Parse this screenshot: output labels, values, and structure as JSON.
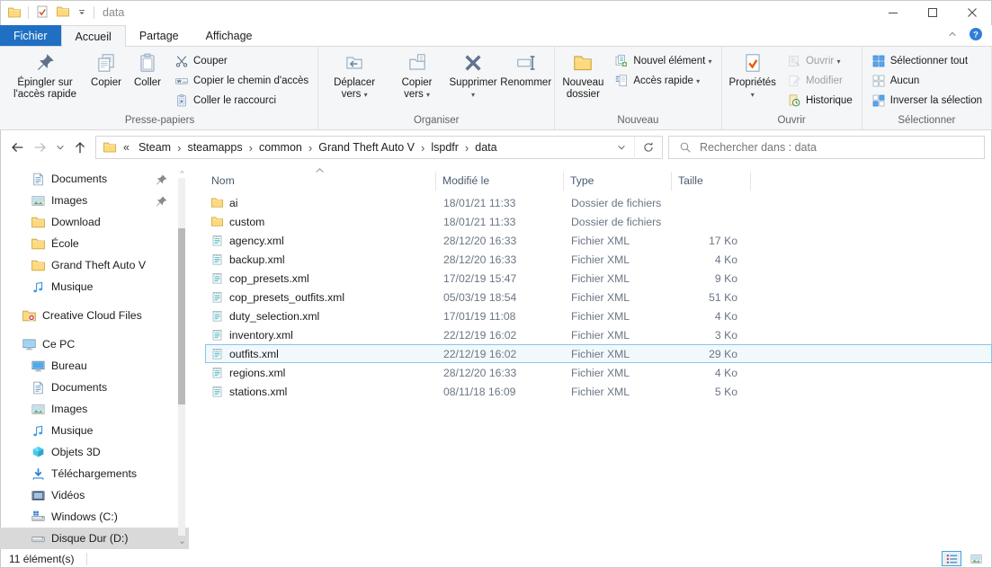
{
  "titlebar": {
    "title": "data"
  },
  "tabs": {
    "file_label": "Fichier",
    "items": [
      {
        "label": "Accueil",
        "active": true
      },
      {
        "label": "Partage",
        "active": false
      },
      {
        "label": "Affichage",
        "active": false
      }
    ]
  },
  "ribbon": {
    "groups": [
      {
        "label": "Presse-papiers",
        "blocks": [
          {
            "kind": "large",
            "label": "Épingler sur l'accès rapide",
            "icon": "pin-icon"
          },
          {
            "kind": "large",
            "label": "Copier",
            "icon": "copy-icon"
          },
          {
            "kind": "large",
            "label": "Coller",
            "icon": "paste-icon"
          },
          {
            "kind": "stack",
            "items": [
              {
                "label": "Couper",
                "icon": "cut-icon"
              },
              {
                "label": "Copier le chemin d'accès",
                "icon": "copy-path-icon"
              },
              {
                "label": "Coller le raccourci",
                "icon": "paste-shortcut-icon"
              }
            ]
          }
        ]
      },
      {
        "label": "Organiser",
        "blocks": [
          {
            "kind": "large",
            "label": "Déplacer vers",
            "icon": "move-to-icon",
            "dropdown": true
          },
          {
            "kind": "large",
            "label": "Copier vers",
            "icon": "copy-to-icon",
            "dropdown": true
          },
          {
            "kind": "large",
            "label": "Supprimer",
            "icon": "delete-icon",
            "dropdown": true
          },
          {
            "kind": "large",
            "label": "Renommer",
            "icon": "rename-icon"
          }
        ]
      },
      {
        "label": "Nouveau",
        "blocks": [
          {
            "kind": "large",
            "label": "Nouveau dossier",
            "icon": "new-folder-icon"
          },
          {
            "kind": "stack",
            "items": [
              {
                "label": "Nouvel élément",
                "icon": "new-item-icon",
                "dropdown": true
              },
              {
                "label": "Accès rapide",
                "icon": "easy-access-icon",
                "dropdown": true
              }
            ]
          }
        ]
      },
      {
        "label": "Ouvrir",
        "blocks": [
          {
            "kind": "large",
            "label": "Propriétés",
            "icon": "properties-icon",
            "dropdown": true
          },
          {
            "kind": "stack",
            "items": [
              {
                "label": "Ouvrir",
                "icon": "open-icon",
                "dropdown": true,
                "disabled": true
              },
              {
                "label": "Modifier",
                "icon": "edit-icon",
                "disabled": true
              },
              {
                "label": "Historique",
                "icon": "history-icon"
              }
            ]
          }
        ]
      },
      {
        "label": "Sélectionner",
        "blocks": [
          {
            "kind": "stack",
            "items": [
              {
                "label": "Sélectionner tout",
                "icon": "select-all-icon"
              },
              {
                "label": "Aucun",
                "icon": "select-none-icon"
              },
              {
                "label": "Inverser la sélection",
                "icon": "invert-selection-icon"
              }
            ]
          }
        ]
      }
    ]
  },
  "nav": {
    "breadcrumb_truncation": "«",
    "breadcrumb": [
      "Steam",
      "steamapps",
      "common",
      "Grand Theft Auto V",
      "lspdfr",
      "data"
    ],
    "search_placeholder": "Rechercher dans : data"
  },
  "sidebar": {
    "items": [
      {
        "label": "Documents",
        "icon": "document-icon",
        "level": 2,
        "pinned": true
      },
      {
        "label": "Images",
        "icon": "image-icon",
        "level": 2,
        "pinned": true
      },
      {
        "label": "Download",
        "icon": "folder-icon",
        "level": 2
      },
      {
        "label": "École",
        "icon": "folder-icon",
        "level": 2
      },
      {
        "label": "Grand Theft Auto V",
        "icon": "folder-icon",
        "level": 2
      },
      {
        "label": "Musique",
        "icon": "music-icon",
        "level": 2
      },
      {
        "label": "Creative Cloud Files",
        "icon": "creative-cloud-icon",
        "level": 1,
        "gap": true
      },
      {
        "label": "Ce PC",
        "icon": "pc-icon",
        "level": 1,
        "gap": true
      },
      {
        "label": "Bureau",
        "icon": "desktop-icon",
        "level": 2
      },
      {
        "label": "Documents",
        "icon": "document-icon",
        "level": 2
      },
      {
        "label": "Images",
        "icon": "image-icon",
        "level": 2
      },
      {
        "label": "Musique",
        "icon": "music-icon",
        "level": 2
      },
      {
        "label": "Objets 3D",
        "icon": "cube-icon",
        "level": 2
      },
      {
        "label": "Téléchargements",
        "icon": "download-icon",
        "level": 2
      },
      {
        "label": "Vidéos",
        "icon": "video-icon",
        "level": 2
      },
      {
        "label": "Windows (C:)",
        "icon": "drive-windows-icon",
        "level": 2
      },
      {
        "label": "Disque Dur (D:)",
        "icon": "drive-icon",
        "level": 2,
        "selected": true
      }
    ]
  },
  "files": {
    "columns": [
      "Nom",
      "Modifié le",
      "Type",
      "Taille"
    ],
    "sorted_by": "Nom",
    "sort_direction": "ascending",
    "rows": [
      {
        "name": "ai",
        "icon": "folder-icon",
        "modified": "18/01/21 11:33",
        "type": "Dossier de fichiers",
        "size": ""
      },
      {
        "name": "custom",
        "icon": "folder-icon",
        "modified": "18/01/21 11:33",
        "type": "Dossier de fichiers",
        "size": ""
      },
      {
        "name": "agency.xml",
        "icon": "xml-file-icon",
        "modified": "28/12/20 16:33",
        "type": "Fichier XML",
        "size": "17 Ko"
      },
      {
        "name": "backup.xml",
        "icon": "xml-file-icon",
        "modified": "28/12/20 16:33",
        "type": "Fichier XML",
        "size": "4 Ko"
      },
      {
        "name": "cop_presets.xml",
        "icon": "xml-file-icon",
        "modified": "17/02/19 15:47",
        "type": "Fichier XML",
        "size": "9 Ko"
      },
      {
        "name": "cop_presets_outfits.xml",
        "icon": "xml-file-icon",
        "modified": "05/03/19 18:54",
        "type": "Fichier XML",
        "size": "51 Ko"
      },
      {
        "name": "duty_selection.xml",
        "icon": "xml-file-icon",
        "modified": "17/01/19 11:08",
        "type": "Fichier XML",
        "size": "4 Ko"
      },
      {
        "name": "inventory.xml",
        "icon": "xml-file-icon",
        "modified": "22/12/19 16:02",
        "type": "Fichier XML",
        "size": "3 Ko"
      },
      {
        "name": "outfits.xml",
        "icon": "xml-file-icon",
        "modified": "22/12/19 16:02",
        "type": "Fichier XML",
        "size": "29 Ko",
        "selected": true
      },
      {
        "name": "regions.xml",
        "icon": "xml-file-icon",
        "modified": "28/12/20 16:33",
        "type": "Fichier XML",
        "size": "4 Ko"
      },
      {
        "name": "stations.xml",
        "icon": "xml-file-icon",
        "modified": "08/11/18 16:09",
        "type": "Fichier XML",
        "size": "5 Ko"
      }
    ]
  },
  "statusbar": {
    "items_count": "11 élément(s)"
  },
  "colors": {
    "file_tab_blue": "#1f70c2",
    "selection_border": "#86c5e8",
    "sidebar_selected_bg": "#d9d9d9",
    "folder_yellow": "#ffd97e",
    "ribbon_bg": "#f5f6f7"
  }
}
